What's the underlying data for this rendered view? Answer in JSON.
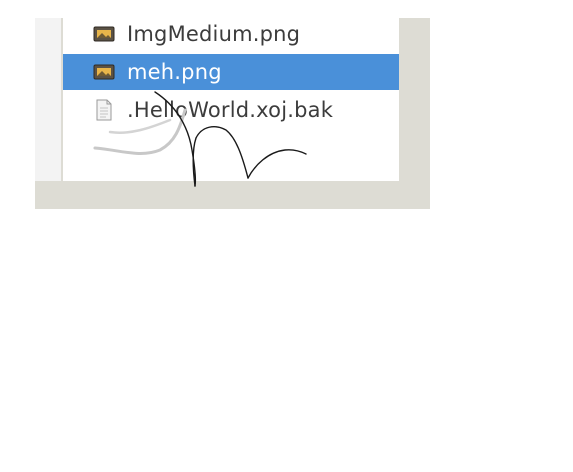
{
  "files": [
    {
      "name": "ImgMedium.png",
      "icon": "image-file-icon",
      "selected": false
    },
    {
      "name": "meh.png",
      "icon": "image-file-icon",
      "selected": true
    },
    {
      "name": ".HelloWorld.xoj.bak",
      "icon": "text-file-icon",
      "selected": false
    }
  ],
  "colors": {
    "selection": "#4a90d9",
    "panel_background": "#dddcd4",
    "list_background": "#ffffff",
    "text": "#3c3c3c"
  }
}
